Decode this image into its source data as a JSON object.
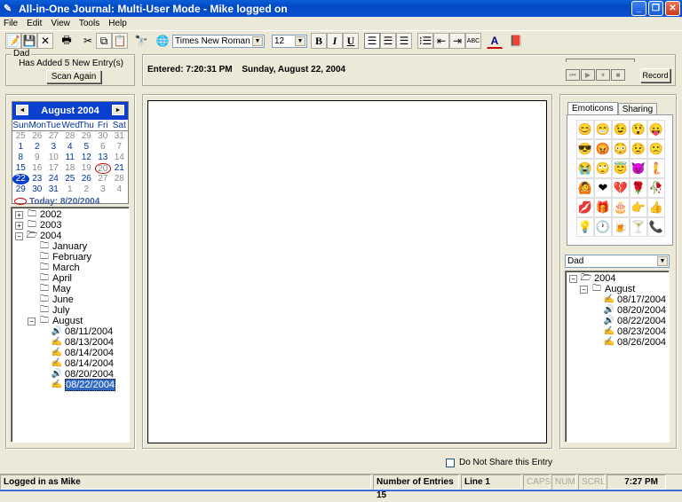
{
  "window": {
    "title": "All-in-One Journal: Multi-User Mode - Mike logged on",
    "minimize": "_",
    "restore": "❐",
    "close": "✕"
  },
  "menu": [
    "File",
    "Edit",
    "View",
    "Tools",
    "Help"
  ],
  "toolbar": {
    "font_name": "Times New Roman",
    "font_size": "12",
    "bold": "B",
    "italic": "I",
    "underline": "U",
    "spell": "ABC",
    "font_color": "A"
  },
  "notify": {
    "group_label": "Dad",
    "message": "Has Added 5 New Entry(s)",
    "scan_button": "Scan Again"
  },
  "entry_info": {
    "entered_label": "Entered:",
    "time": "7:20:31 PM",
    "date": "Sunday, August 22, 2004"
  },
  "recorder": {
    "record_button": "Record",
    "controls": [
      "rewind",
      "play",
      "pause",
      "stop"
    ]
  },
  "calendar": {
    "month_label": "August 2004",
    "prev": "◄",
    "next": "►",
    "days_of_week": [
      "Sun",
      "Mon",
      "Tue",
      "Wed",
      "Thu",
      "Fri",
      "Sat"
    ],
    "weeks": [
      [
        "25",
        "26",
        "27",
        "28",
        "29",
        "30",
        "31"
      ],
      [
        "1",
        "2",
        "3",
        "4",
        "5",
        "6",
        "7"
      ],
      [
        "8",
        "9",
        "10",
        "11",
        "12",
        "13",
        "14"
      ],
      [
        "15",
        "16",
        "17",
        "18",
        "19",
        "20",
        "21"
      ],
      [
        "22",
        "23",
        "24",
        "25",
        "26",
        "27",
        "28"
      ],
      [
        "29",
        "30",
        "31",
        "1",
        "2",
        "3",
        "4"
      ]
    ],
    "today_label": "Today: 8/20/2004",
    "today": "20",
    "selected": "22"
  },
  "left_tree": {
    "years": [
      "2002",
      "2003",
      "2004"
    ],
    "months": [
      "January",
      "February",
      "March",
      "April",
      "May",
      "June",
      "July",
      "August"
    ],
    "entries": [
      {
        "date": "08/11/2004",
        "type": "audio"
      },
      {
        "date": "08/13/2004",
        "type": "text"
      },
      {
        "date": "08/14/2004",
        "type": "text"
      },
      {
        "date": "08/14/2004",
        "type": "text"
      },
      {
        "date": "08/20/2004",
        "type": "audio"
      },
      {
        "date": "08/22/2004",
        "type": "text",
        "selected": true
      }
    ]
  },
  "right_panel": {
    "tabs": [
      "Emoticons",
      "Sharing"
    ],
    "emoticons": [
      "😊",
      "😁",
      "😉",
      "😲",
      "😛",
      "😎",
      "😡",
      "😳",
      "😟",
      "🙁",
      "😭",
      "🙄",
      "😇",
      "😈",
      "🧜",
      "🙆",
      "❤",
      "💔",
      "🌹",
      "🥀",
      "💋",
      "🎁",
      "🎂",
      "👉",
      "👍",
      "💡",
      "🕐",
      "🍺",
      "🍸",
      "📞"
    ],
    "user_select": "Dad",
    "tree": {
      "year": "2004",
      "month": "August",
      "entries": [
        {
          "date": "08/17/2004",
          "type": "text"
        },
        {
          "date": "08/20/2004",
          "type": "audio"
        },
        {
          "date": "08/22/2004",
          "type": "audio"
        },
        {
          "date": "08/23/2004",
          "type": "text"
        },
        {
          "date": "08/26/2004",
          "type": "text"
        }
      ]
    }
  },
  "share_checkbox": {
    "label": "Do Not Share this Entry",
    "checked": false
  },
  "status": {
    "user": "Logged in as Mike",
    "entries": "Number of Entries 15",
    "line": "Line 1",
    "caps": "CAPS",
    "num": "NUM",
    "scrl": "SCRL",
    "clock": "7:27 PM"
  }
}
